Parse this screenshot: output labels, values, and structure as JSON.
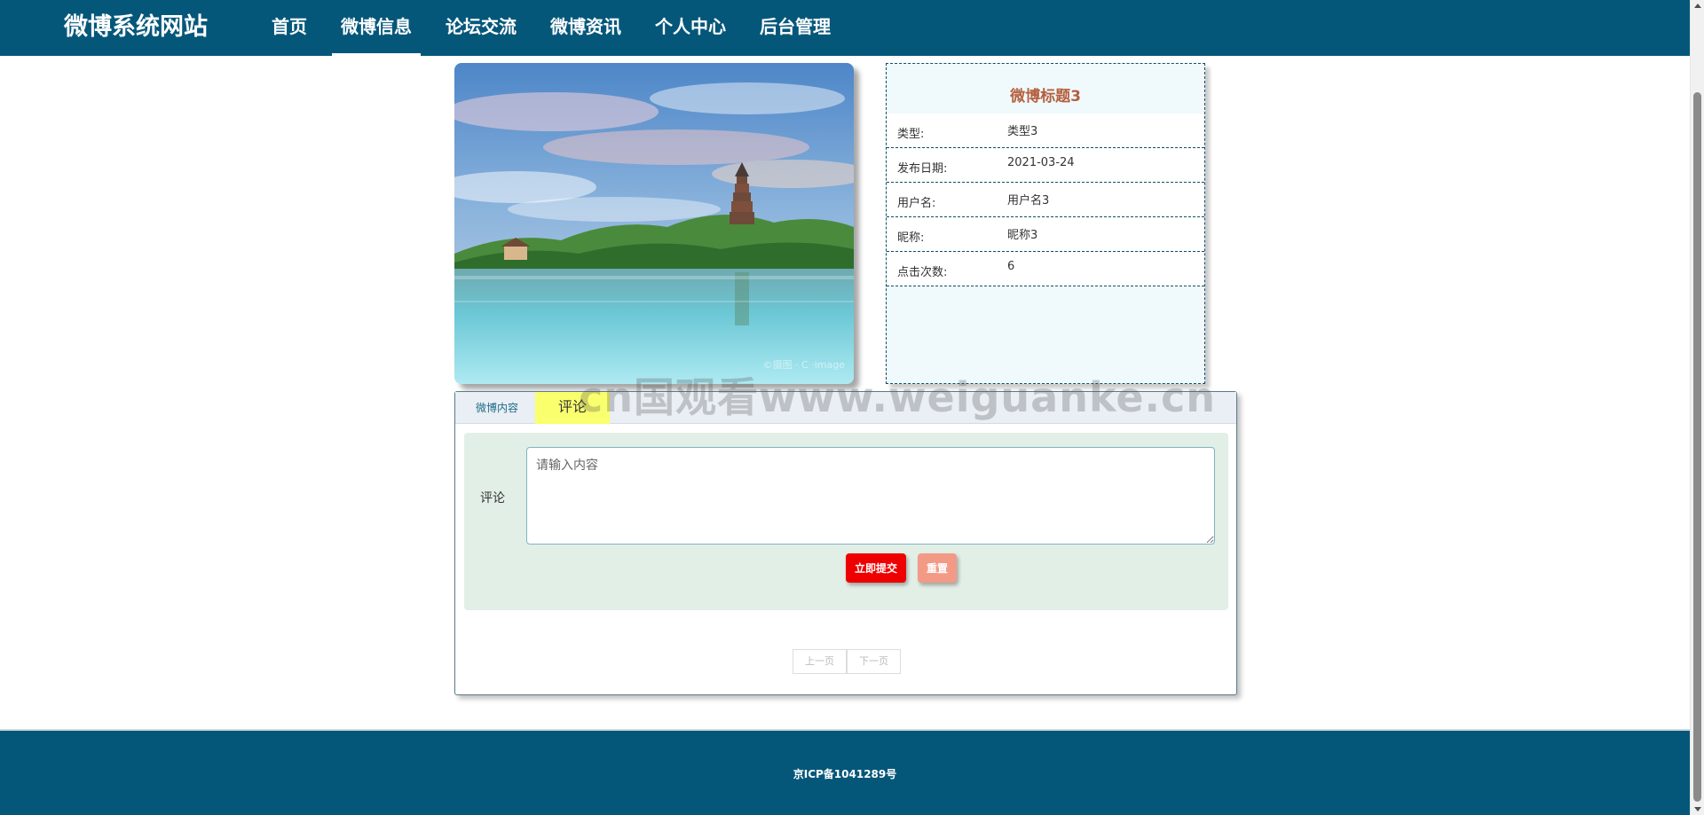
{
  "header": {
    "brand": "微博系统网站",
    "nav": [
      {
        "label": "首页",
        "active": false
      },
      {
        "label": "微博信息",
        "active": true
      },
      {
        "label": "论坛交流",
        "active": false
      },
      {
        "label": "微博资讯",
        "active": false
      },
      {
        "label": "个人中心",
        "active": false
      },
      {
        "label": "后台管理",
        "active": false
      }
    ]
  },
  "photo": {
    "watermark_text": "©摄图 · C ·image"
  },
  "detail": {
    "title": "微博标题3",
    "rows": [
      {
        "label": "类型:",
        "value": "类型3"
      },
      {
        "label": "发布日期:",
        "value": "2021-03-24"
      },
      {
        "label": "用户名:",
        "value": "用户名3"
      },
      {
        "label": "昵称:",
        "value": "昵称3"
      },
      {
        "label": "点击次数:",
        "value": "6"
      }
    ]
  },
  "tabs": {
    "content_label": "微博内容",
    "comment_label": "评论"
  },
  "comment_form": {
    "label": "评论",
    "placeholder": "请输入内容",
    "value": "",
    "submit_label": "立即提交",
    "reset_label": "重置"
  },
  "pager": {
    "prev_label": "上一页",
    "next_label": "下一页"
  },
  "watermark": "cn国观看www.weiguanke.cn",
  "footer": {
    "icp": "京ICP备1041289号"
  },
  "colors": {
    "header_bg": "#05577a",
    "title": "#b5603f",
    "submit": "#ef0000",
    "reset": "#f39a86",
    "active_tab": "#faff6e"
  }
}
